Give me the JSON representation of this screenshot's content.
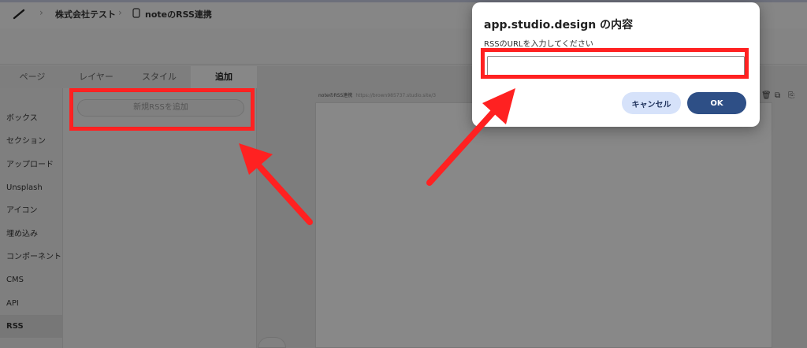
{
  "breadcrumb": {
    "project": "株式会社テスト",
    "page": "noteのRSS連携"
  },
  "panel_tabs": [
    "ページ",
    "レイヤー",
    "スタイル",
    "追加"
  ],
  "sidebar": {
    "items": [
      "ボックス",
      "セクション",
      "アップロード",
      "Unsplash",
      "アイコン",
      "埋め込み",
      "コンポーネント",
      "CMS",
      "API",
      "RSS"
    ],
    "active": "RSS"
  },
  "content": {
    "add_rss_label": "新規RSSを追加"
  },
  "canvas": {
    "page_name": "noteのRSS連携",
    "page_url": "https://brown985737.studio.site/3"
  },
  "dialog": {
    "title": "app.studio.design の内容",
    "message": "RSSのURLを入力してください",
    "input_value": "",
    "cancel_label": "キャンセル",
    "ok_label": "OK"
  },
  "colors": {
    "highlight": "#ff2121",
    "ok_button": "#2e4f86",
    "cancel_button": "#d6e2fa"
  }
}
